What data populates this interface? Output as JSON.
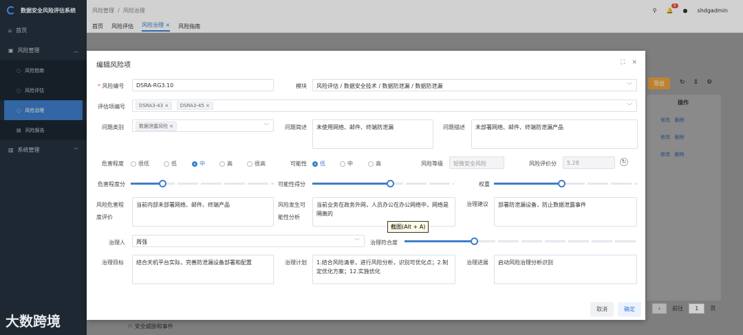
{
  "app": {
    "title": "数据安全风险评估系统"
  },
  "sidebar": {
    "items": [
      {
        "label": "首页"
      },
      {
        "label": "风险管理"
      },
      {
        "label": "风险指南"
      },
      {
        "label": "风险评估"
      },
      {
        "label": "风险治理"
      },
      {
        "label": "风险报告"
      },
      {
        "label": "系统管理"
      }
    ]
  },
  "header": {
    "breadcrumb_1": "风险管理",
    "breadcrumb_sep": "/",
    "breadcrumb_2": "风险治理",
    "notify_count": "9",
    "username": "shdgadmin"
  },
  "tabs": [
    {
      "label": "首页"
    },
    {
      "label": "风险评估"
    },
    {
      "label": "风险治理 ×"
    },
    {
      "label": "风险指南"
    }
  ],
  "background": {
    "export_label": "导出",
    "op_header": "操作",
    "edit_label": "修改",
    "delete_label": "删除",
    "pager_goto": "前往",
    "pager_page": "1",
    "pager_unit": "页",
    "bottom_item": "安全威胁和事件"
  },
  "modal": {
    "title": "编辑风险项",
    "fields": {
      "risk_no_label": "风险编号",
      "risk_no_value": "DSRA-RG3.10",
      "module_label": "模块",
      "module_value": "风险评估 / 数据安全技术 / 数据防泄漏 / 数据防泄漏",
      "eval_no_label": "评估项编号",
      "eval_tags": [
        "DSRA3-43",
        "DSRA3-45"
      ],
      "issue_type_label": "问题类别",
      "issue_type_tag": "数据泄露风险",
      "issue_desc_label": "问题简述",
      "issue_desc_value": "未使用网络、邮件、终端防泄漏",
      "issue_detail_label": "问题描述",
      "issue_detail_value": "未部署网络、邮件、终端防泄漏产品",
      "severity_label": "危害程度",
      "severity_options": [
        "很低",
        "低",
        "中",
        "高",
        "很高"
      ],
      "severity_selected": "中",
      "likelihood_label": "可能性",
      "likelihood_options": [
        "低",
        "中",
        "高"
      ],
      "likelihood_selected": "低",
      "risk_level_label": "风险等级",
      "risk_level_value": "轻微安全风险",
      "risk_score_label": "风险评价分",
      "risk_score_value": "5.28",
      "severity_score_label": "危害程度分",
      "severity_score": 0.22,
      "likelihood_score_label": "可能性得分",
      "likelihood_score": 0.55,
      "weight_label": "权重",
      "weight_score": 0.47,
      "severity_eval_label": "风险危害程度评价",
      "severity_eval_value": "当前内部未部署网络、邮件、终端产品",
      "cause_label": "风险发生可能性分析",
      "cause_value": "当前业务在政务外网，人员办公在办公网络中，网络是隔离的",
      "advice_label": "治理建议",
      "advice_value": "部署防泄漏设备，防止数据泄露事件",
      "owner_label": "治理人",
      "owner_value": "周强",
      "conformity_label": "治理符合度",
      "conformity_score": 0.3,
      "goal_label": "治理目标",
      "goal_value": "结合天机平台实际，完善防泄漏设备部署和配置",
      "plan_label": "治理计划",
      "plan_value": "1.结合风险清单，进行风险分析，识别可优化点；2.制定优化方案；12.实施优化",
      "progress_label": "治理进展",
      "progress_value": "启动风险治理分析识别"
    },
    "tooltip": "截图(Alt + A)",
    "cancel_label": "取消",
    "ok_label": "确定"
  },
  "watermark": "大数跨境",
  "colors": {
    "accent": "#3e7dc9",
    "sidebar": "#24313f"
  }
}
